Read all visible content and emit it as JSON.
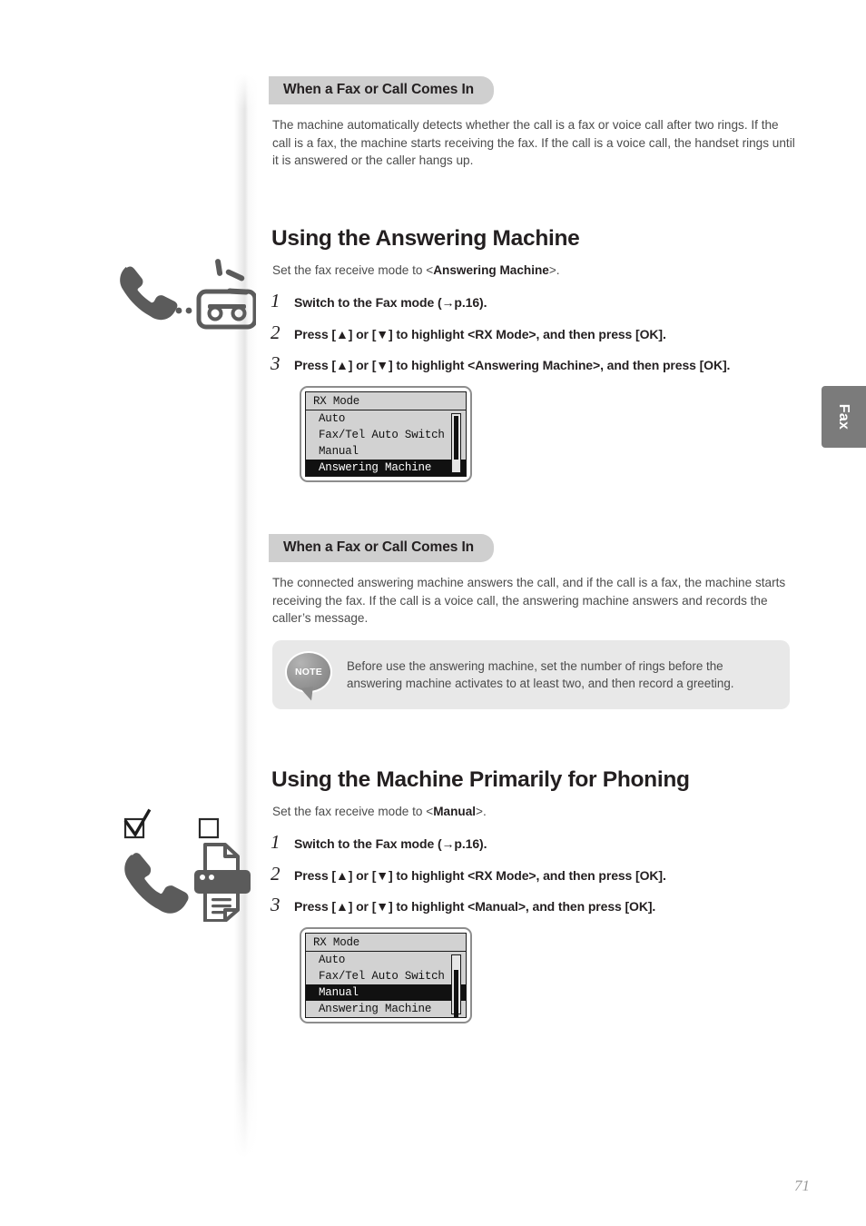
{
  "page": {
    "number": "71",
    "side_tab_label": "Fax"
  },
  "sections": [
    {
      "badge": "When a Fax or Call Comes In",
      "body": "The machine automatically detects whether the call is a fax or voice call after two rings. If the call is a fax, the machine starts receiving the fax. If the call is a voice call, the handset rings until it is answered or the caller hangs up."
    },
    {
      "title": "Using the Answering Machine",
      "lead_prefix": "Set the fax receive mode to <",
      "lead_bold": "Answering Machine",
      "lead_suffix": ">.",
      "steps": [
        {
          "num": "1",
          "text": "Switch to the Fax mode (→p.16)."
        },
        {
          "num": "2",
          "text": "Press [▲] or [▼] to highlight <RX Mode>, and then press [OK]."
        },
        {
          "num": "3",
          "text": "Press [▲] or [▼] to highlight <Answering Machine>, and then press [OK]."
        }
      ],
      "lcd": {
        "title": "RX Mode",
        "rows": [
          "Auto",
          "Fax/Tel Auto Switch",
          "Manual",
          "Answering Machine"
        ],
        "selected": "Answering Machine"
      }
    },
    {
      "badge": "When a Fax or Call Comes In",
      "body": "The connected answering machine answers the call, and if the call is a fax, the machine starts receiving the fax. If the call is a voice call, the answering machine answers and records the caller’s message."
    },
    {
      "note": {
        "label": "NOTE",
        "text": "Before use the answering machine, set the number of rings before the answering machine activates to at least two, and then record a greeting."
      }
    },
    {
      "title": "Using the Machine Primarily for Phoning",
      "lead_prefix": "Set the fax receive mode to <",
      "lead_bold": "Manual",
      "lead_suffix": ">.",
      "steps": [
        {
          "num": "1",
          "text": "Switch to the Fax mode (→p.16)."
        },
        {
          "num": "2",
          "text": "Press [▲] or [▼] to highlight <RX Mode>, and then press [OK]."
        },
        {
          "num": "3",
          "text": "Press [▲] or [▼] to highlight <Manual>, and then press [OK]."
        }
      ],
      "lcd": {
        "title": "RX Mode",
        "rows": [
          "Auto",
          "Fax/Tel Auto Switch",
          "Manual",
          "Answering Machine"
        ],
        "selected": "Manual"
      }
    }
  ],
  "illustrations": {
    "answering_machine": "handset-to-cassette-icon",
    "phoning": "handset-checked-fax-unchecked-icon"
  },
  "colors": {
    "badge_bg": "#cfcfcf",
    "note_bg": "#e8e8e8",
    "tab_bg": "#7b7b7b",
    "lcd_bg": "#d2d2d2",
    "text": "#231f20",
    "body_text": "#4b4b4b"
  }
}
